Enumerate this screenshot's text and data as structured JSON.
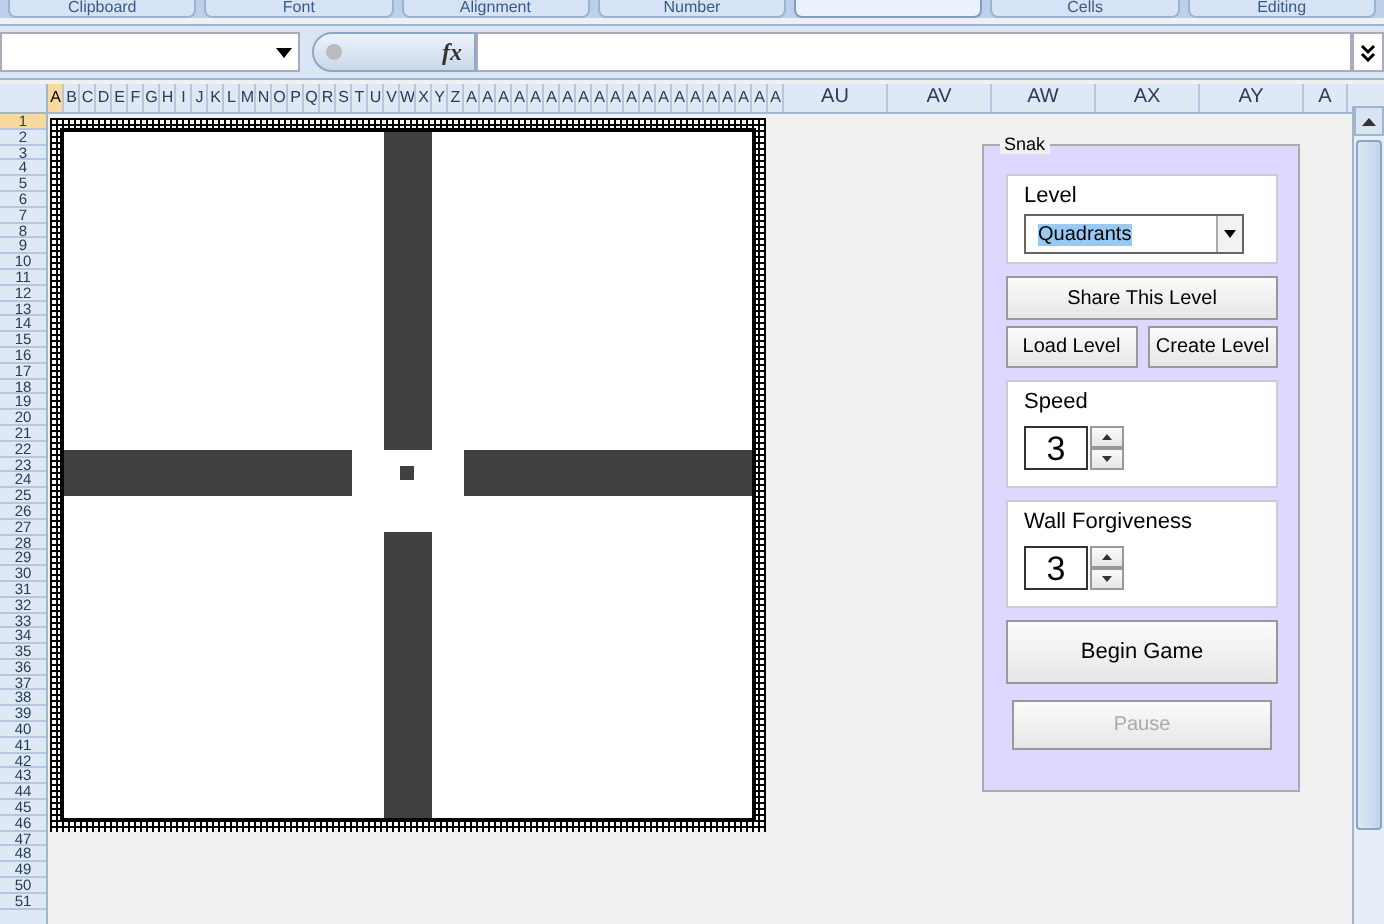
{
  "ribbon_groups": [
    {
      "label": "Clipboard"
    },
    {
      "label": "Font"
    },
    {
      "label": "Alignment"
    },
    {
      "label": "Number"
    },
    {
      "kind": "blank"
    },
    {
      "label": "Cells"
    },
    {
      "label": "Editing"
    }
  ],
  "formula_bar": {
    "fx": "fx"
  },
  "columns": [
    {
      "label": "A",
      "selected": true
    },
    {
      "label": "B",
      "selected": false
    },
    {
      "label": "C",
      "selected": false
    },
    {
      "label": "D",
      "selected": false
    },
    {
      "label": "E",
      "selected": false
    },
    {
      "label": "F",
      "selected": false
    },
    {
      "label": "G",
      "selected": false
    },
    {
      "label": "H",
      "selected": false
    },
    {
      "label": "I",
      "selected": false
    },
    {
      "label": "J",
      "selected": false
    },
    {
      "label": "K",
      "selected": false
    },
    {
      "label": "L",
      "selected": false
    },
    {
      "label": "M",
      "selected": false
    },
    {
      "label": "N",
      "selected": false
    },
    {
      "label": "O",
      "selected": false
    },
    {
      "label": "P",
      "selected": false
    },
    {
      "label": "Q",
      "selected": false
    },
    {
      "label": "R",
      "selected": false
    },
    {
      "label": "S",
      "selected": false
    },
    {
      "label": "T",
      "selected": false
    },
    {
      "label": "U",
      "selected": false
    },
    {
      "label": "V",
      "selected": false
    },
    {
      "label": "W",
      "selected": false
    },
    {
      "label": "X",
      "selected": false
    },
    {
      "label": "Y",
      "selected": false
    },
    {
      "label": "Z",
      "selected": false
    },
    {
      "label": "A",
      "selected": false
    },
    {
      "label": "A",
      "selected": false
    },
    {
      "label": "A",
      "selected": false
    },
    {
      "label": "A",
      "selected": false
    },
    {
      "label": "A",
      "selected": false
    },
    {
      "label": "A",
      "selected": false
    },
    {
      "label": "A",
      "selected": false
    },
    {
      "label": "A",
      "selected": false
    },
    {
      "label": "A",
      "selected": false
    },
    {
      "label": "A",
      "selected": false
    },
    {
      "label": "A",
      "selected": false
    },
    {
      "label": "A",
      "selected": false
    },
    {
      "label": "A",
      "selected": false
    },
    {
      "label": "A",
      "selected": false
    },
    {
      "label": "A",
      "selected": false
    },
    {
      "label": "A",
      "selected": false
    },
    {
      "label": "A",
      "selected": false
    },
    {
      "label": "A",
      "selected": false
    },
    {
      "label": "A",
      "selected": false
    },
    {
      "label": "A",
      "selected": false
    },
    {
      "label": "AU",
      "selected": false
    },
    {
      "label": "AV",
      "selected": false
    },
    {
      "label": "AW",
      "selected": false
    },
    {
      "label": "AX",
      "selected": false
    },
    {
      "label": "AY",
      "selected": false
    },
    {
      "label": "A",
      "selected": false
    }
  ],
  "rows": [
    {
      "label": "1",
      "selected": true
    },
    {
      "label": "2",
      "selected": false
    },
    {
      "label": "3",
      "selected": false
    },
    {
      "label": "4",
      "selected": false
    },
    {
      "label": "5",
      "selected": false
    },
    {
      "label": "6",
      "selected": false
    },
    {
      "label": "7",
      "selected": false
    },
    {
      "label": "8",
      "selected": false
    },
    {
      "label": "9",
      "selected": false
    },
    {
      "label": "10",
      "selected": false
    },
    {
      "label": "11",
      "selected": false
    },
    {
      "label": "12",
      "selected": false
    },
    {
      "label": "13",
      "selected": false
    },
    {
      "label": "14",
      "selected": false
    },
    {
      "label": "15",
      "selected": false
    },
    {
      "label": "16",
      "selected": false
    },
    {
      "label": "17",
      "selected": false
    },
    {
      "label": "18",
      "selected": false
    },
    {
      "label": "19",
      "selected": false
    },
    {
      "label": "20",
      "selected": false
    },
    {
      "label": "21",
      "selected": false
    },
    {
      "label": "22",
      "selected": false
    },
    {
      "label": "23",
      "selected": false
    },
    {
      "label": "24",
      "selected": false
    },
    {
      "label": "25",
      "selected": false
    },
    {
      "label": "26",
      "selected": false
    },
    {
      "label": "27",
      "selected": false
    },
    {
      "label": "28",
      "selected": false
    },
    {
      "label": "29",
      "selected": false
    },
    {
      "label": "30",
      "selected": false
    },
    {
      "label": "31",
      "selected": false
    },
    {
      "label": "32",
      "selected": false
    },
    {
      "label": "33",
      "selected": false
    },
    {
      "label": "34",
      "selected": false
    },
    {
      "label": "35",
      "selected": false
    },
    {
      "label": "36",
      "selected": false
    },
    {
      "label": "37",
      "selected": false
    },
    {
      "label": "38",
      "selected": false
    },
    {
      "label": "39",
      "selected": false
    },
    {
      "label": "40",
      "selected": false
    },
    {
      "label": "41",
      "selected": false
    },
    {
      "label": "42",
      "selected": false
    },
    {
      "label": "43",
      "selected": false
    },
    {
      "label": "44",
      "selected": false
    },
    {
      "label": "45",
      "selected": false
    },
    {
      "label": "46",
      "selected": false
    },
    {
      "label": "47",
      "selected": false
    },
    {
      "label": "48",
      "selected": false
    },
    {
      "label": "49",
      "selected": false
    },
    {
      "label": "50",
      "selected": false
    },
    {
      "label": "51",
      "selected": false
    }
  ],
  "panel": {
    "title": "Snak",
    "level_label": "Level",
    "level_value": "Quadrants",
    "share_button": "Share This Level",
    "load_button": "Load Level",
    "create_button": "Create Level",
    "speed_label": "Speed",
    "speed_value": "3",
    "wall_label": "Wall Forgiveness",
    "wall_value": "3",
    "begin_button": "Begin Game",
    "pause_button": {
      "label": "Pause",
      "disabled": true
    }
  }
}
